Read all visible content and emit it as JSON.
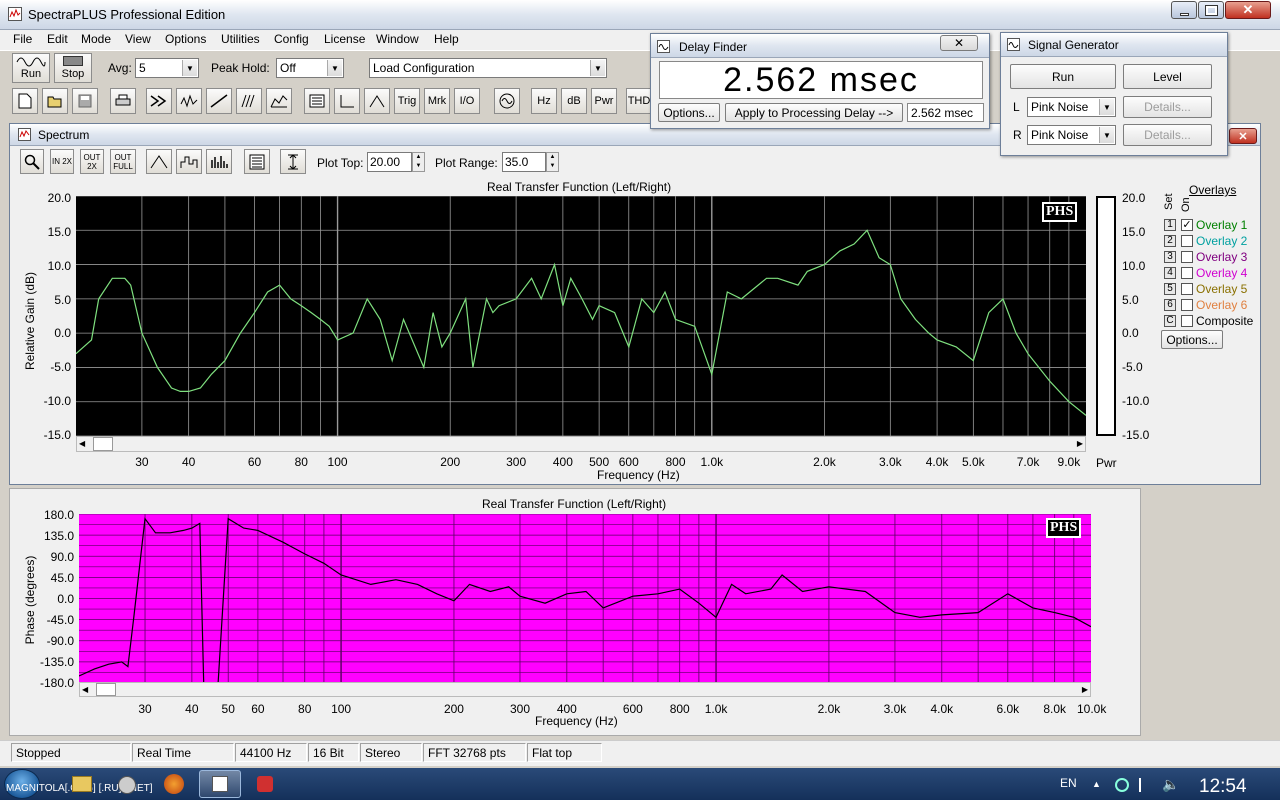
{
  "app": {
    "title": "SpectraPLUS Professional Edition"
  },
  "menu": [
    "File",
    "Edit",
    "Mode",
    "View",
    "Options",
    "Utilities",
    "Config",
    "License",
    "Window",
    "Help"
  ],
  "toolbar": {
    "run_label": "Run",
    "stop_label": "Stop",
    "avg_label": "Avg:",
    "avg_value": "5",
    "peak_hold_label": "Peak Hold:",
    "peak_hold_value": "Off",
    "config_value": "Load Configuration",
    "icons": [
      "Trig",
      "Mrk",
      "I/O",
      "Hz",
      "dB",
      "Pwr",
      "THD"
    ]
  },
  "delay_finder": {
    "title": "Delay Finder",
    "value": "2.562 msec",
    "options_label": "Options...",
    "apply_label": "Apply to Processing Delay -->",
    "readout": "2.562 msec"
  },
  "signal_generator": {
    "title": "Signal Generator",
    "run_label": "Run",
    "level_label": "Level",
    "left_label": "L",
    "right_label": "R",
    "left_value": "Pink Noise",
    "right_value": "Pink Noise",
    "details_label": "Details..."
  },
  "spectrum": {
    "title": "Spectrum",
    "zoom_labels": [
      "IN 2X",
      "OUT 2X",
      "OUT FULL"
    ],
    "plot_top_label": "Plot Top:",
    "plot_top_value": "20.00",
    "plot_range_label": "Plot Range:",
    "plot_range_value": "35.0",
    "pwr_label": "Pwr"
  },
  "overlays": {
    "title": "Overlays",
    "set_label": "Set",
    "on_label": "On",
    "items": [
      {
        "set": "1",
        "label": "Overlay 1",
        "checked": true,
        "color": "#008000"
      },
      {
        "set": "2",
        "label": "Overlay 2",
        "checked": false,
        "color": "#00a0a0"
      },
      {
        "set": "3",
        "label": "Overlay 3",
        "checked": false,
        "color": "#800080"
      },
      {
        "set": "4",
        "label": "Overlay 4",
        "checked": false,
        "color": "#d000d0"
      },
      {
        "set": "5",
        "label": "Overlay 5",
        "checked": false,
        "color": "#8a7000"
      },
      {
        "set": "6",
        "label": "Overlay 6",
        "checked": false,
        "color": "#e08040"
      },
      {
        "set": "C",
        "label": "Composite",
        "checked": false,
        "color": "#000000"
      }
    ],
    "options_label": "Options..."
  },
  "chart_data": [
    {
      "type": "line",
      "title": "Real Transfer Function (Left/Right)",
      "xlabel": "Frequency (Hz)",
      "ylabel": "Relative Gain (dB)",
      "x_scale": "log",
      "xlim": [
        20,
        10000
      ],
      "ylim": [
        -15,
        20
      ],
      "x_tick_labels": [
        "30",
        "40",
        "60",
        "80",
        "100",
        "200",
        "300",
        "400",
        "500",
        "600",
        "800",
        "1.0k",
        "2.0k",
        "3.0k",
        "4.0k",
        "5.0k",
        "7.0k",
        "9.0k"
      ],
      "y_tick_labels": [
        "20.0",
        "15.0",
        "10.0",
        "5.0",
        "0.0",
        "-5.0",
        "-10.0",
        "-15.0"
      ],
      "logo": "PHS",
      "background": "#000000",
      "line_color": "#7fe07f",
      "series": [
        {
          "x": [
            20,
            22,
            23,
            25,
            27,
            28,
            30,
            33,
            36,
            38,
            40,
            43,
            46,
            50,
            55,
            60,
            65,
            70,
            75,
            80,
            85,
            90,
            95,
            100,
            110,
            120,
            130,
            140,
            150,
            170,
            180,
            190,
            200,
            220,
            230,
            250,
            260,
            270,
            300,
            330,
            350,
            380,
            400,
            420,
            450,
            480,
            500,
            550,
            600,
            650,
            700,
            750,
            800,
            900,
            1000,
            1100,
            1200,
            1400,
            1500,
            1700,
            1800,
            2000,
            2200,
            2400,
            2600,
            2800,
            3000,
            3200,
            3500,
            3800,
            4000,
            4500,
            5000,
            5500,
            6000,
            6500,
            7000,
            8000,
            9000,
            10000
          ],
          "y": [
            -3,
            -1,
            5,
            8,
            8,
            7,
            0,
            -5,
            -8,
            -8.5,
            -8.5,
            -8,
            -6,
            -4,
            0,
            3,
            6,
            7,
            5,
            4,
            3,
            2,
            1,
            -1,
            0,
            5,
            2,
            -4,
            2,
            -5,
            3,
            -2,
            0,
            5,
            -5,
            5,
            3,
            4,
            5,
            8,
            5,
            10,
            4,
            8,
            5,
            2,
            4,
            3,
            -2,
            5,
            3,
            6,
            2,
            1,
            -6,
            6,
            5,
            8,
            8,
            7,
            9,
            10,
            12,
            13,
            15,
            11,
            10,
            5,
            2,
            0,
            -1,
            -2,
            -4,
            3,
            5,
            0,
            -3,
            -7,
            -10,
            -12
          ]
        }
      ]
    },
    {
      "type": "line",
      "title": "Real Transfer Function (Left/Right)",
      "xlabel": "Frequency (Hz)",
      "ylabel": "Phase (degrees)",
      "x_scale": "log",
      "xlim": [
        20,
        10000
      ],
      "ylim": [
        -180,
        180
      ],
      "x_tick_labels": [
        "30",
        "40",
        "50",
        "60",
        "80",
        "100",
        "200",
        "300",
        "400",
        "600",
        "800",
        "1.0k",
        "2.0k",
        "3.0k",
        "4.0k",
        "6.0k",
        "8.0k",
        "10.0k"
      ],
      "y_tick_labels": [
        "180.0",
        "135.0",
        "90.0",
        "45.0",
        "0.0",
        "-45.0",
        "-90.0",
        "-135.0",
        "-180.0"
      ],
      "logo": "PHS",
      "background": "#ff00ff",
      "line_color": "#000000",
      "series": [
        {
          "x": [
            20,
            22,
            24,
            26,
            27,
            28,
            30,
            32,
            35,
            38,
            40,
            42,
            43,
            45,
            47,
            50,
            55,
            60,
            70,
            80,
            90,
            100,
            120,
            140,
            160,
            180,
            200,
            220,
            250,
            280,
            300,
            350,
            400,
            450,
            500,
            600,
            700,
            800,
            900,
            1000,
            1100,
            1200,
            1400,
            1500,
            1700,
            2000,
            2500,
            3000,
            3500,
            4000,
            5000,
            6000,
            7000,
            8000,
            9000,
            10000
          ],
          "y": [
            -165,
            -150,
            -140,
            -135,
            -145,
            -40,
            170,
            140,
            140,
            145,
            150,
            160,
            -180,
            -180,
            -180,
            170,
            150,
            145,
            120,
            95,
            75,
            50,
            30,
            40,
            30,
            10,
            -5,
            30,
            15,
            25,
            5,
            -10,
            10,
            15,
            -20,
            5,
            10,
            20,
            -10,
            -40,
            30,
            10,
            20,
            50,
            15,
            25,
            15,
            -30,
            -40,
            -35,
            -30,
            10,
            -20,
            -30,
            -40,
            -60
          ]
        }
      ]
    }
  ],
  "status_bar": [
    "Stopped",
    "Real Time",
    "44100 Hz",
    "16 Bit",
    "Stereo",
    "FFT 32768 pts",
    "Flat top"
  ],
  "taskbar": {
    "clock": "12:54",
    "lang": "EN",
    "watermark": "MAGNITOLA[.ORG] [.RU] [.NET]"
  }
}
